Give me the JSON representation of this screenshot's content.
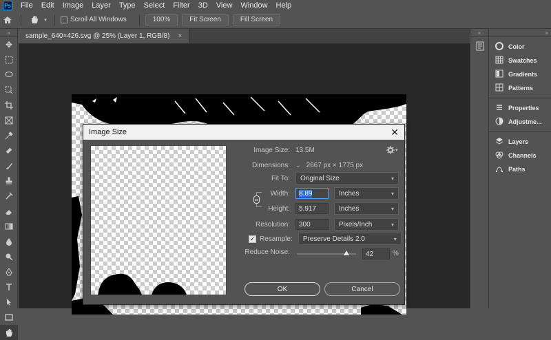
{
  "menu": {
    "logo": "Ps",
    "items": [
      "File",
      "Edit",
      "Image",
      "Layer",
      "Type",
      "Select",
      "Filter",
      "3D",
      "View",
      "Window",
      "Help"
    ]
  },
  "options": {
    "scroll_all_windows": "Scroll All Windows",
    "zoom_100": "100%",
    "fit_screen": "Fit Screen",
    "fill_screen": "Fill Screen"
  },
  "document": {
    "tab_title": "sample_640×426.svg @ 25% (Layer 1, RGB/8)",
    "close_glyph": "×"
  },
  "panels": {
    "items": [
      {
        "label": "Color",
        "icon": "color-wheel-icon"
      },
      {
        "label": "Swatches",
        "icon": "grid-icon"
      },
      {
        "label": "Gradients",
        "icon": "gradient-icon"
      },
      {
        "label": "Patterns",
        "icon": "pattern-icon"
      },
      {
        "label": "Properties",
        "icon": "properties-icon"
      },
      {
        "label": "Adjustme...",
        "icon": "adjustments-icon"
      },
      {
        "label": "Layers",
        "icon": "layers-icon"
      },
      {
        "label": "Channels",
        "icon": "channels-icon"
      },
      {
        "label": "Paths",
        "icon": "paths-icon"
      }
    ]
  },
  "dialog": {
    "title": "Image Size",
    "close": "✕",
    "image_size_label": "Image Size:",
    "image_size_value": "13.5M",
    "dimensions_label": "Dimensions:",
    "dimensions_value": "2667 px × 1775 px",
    "fit_to_label": "Fit To:",
    "fit_to_value": "Original Size",
    "width_label": "Width:",
    "width_value": "8.89",
    "width_unit": "Inches",
    "height_label": "Height:",
    "height_value": "5.917",
    "height_unit": "Inches",
    "resolution_label": "Resolution:",
    "resolution_value": "300",
    "resolution_unit": "Pixels/Inch",
    "resample_label": "Resample:",
    "resample_value": "Preserve Details 2.0",
    "resample_checked": true,
    "reduce_noise_label": "Reduce Noise:",
    "reduce_noise_value": "42",
    "reduce_noise_percent": 42,
    "percent_sign": "%",
    "ok_label": "OK",
    "cancel_label": "Cancel"
  },
  "colors": {
    "app_bg": "#535353",
    "canvas_bg": "#282828",
    "accent": "#4a9eff"
  }
}
